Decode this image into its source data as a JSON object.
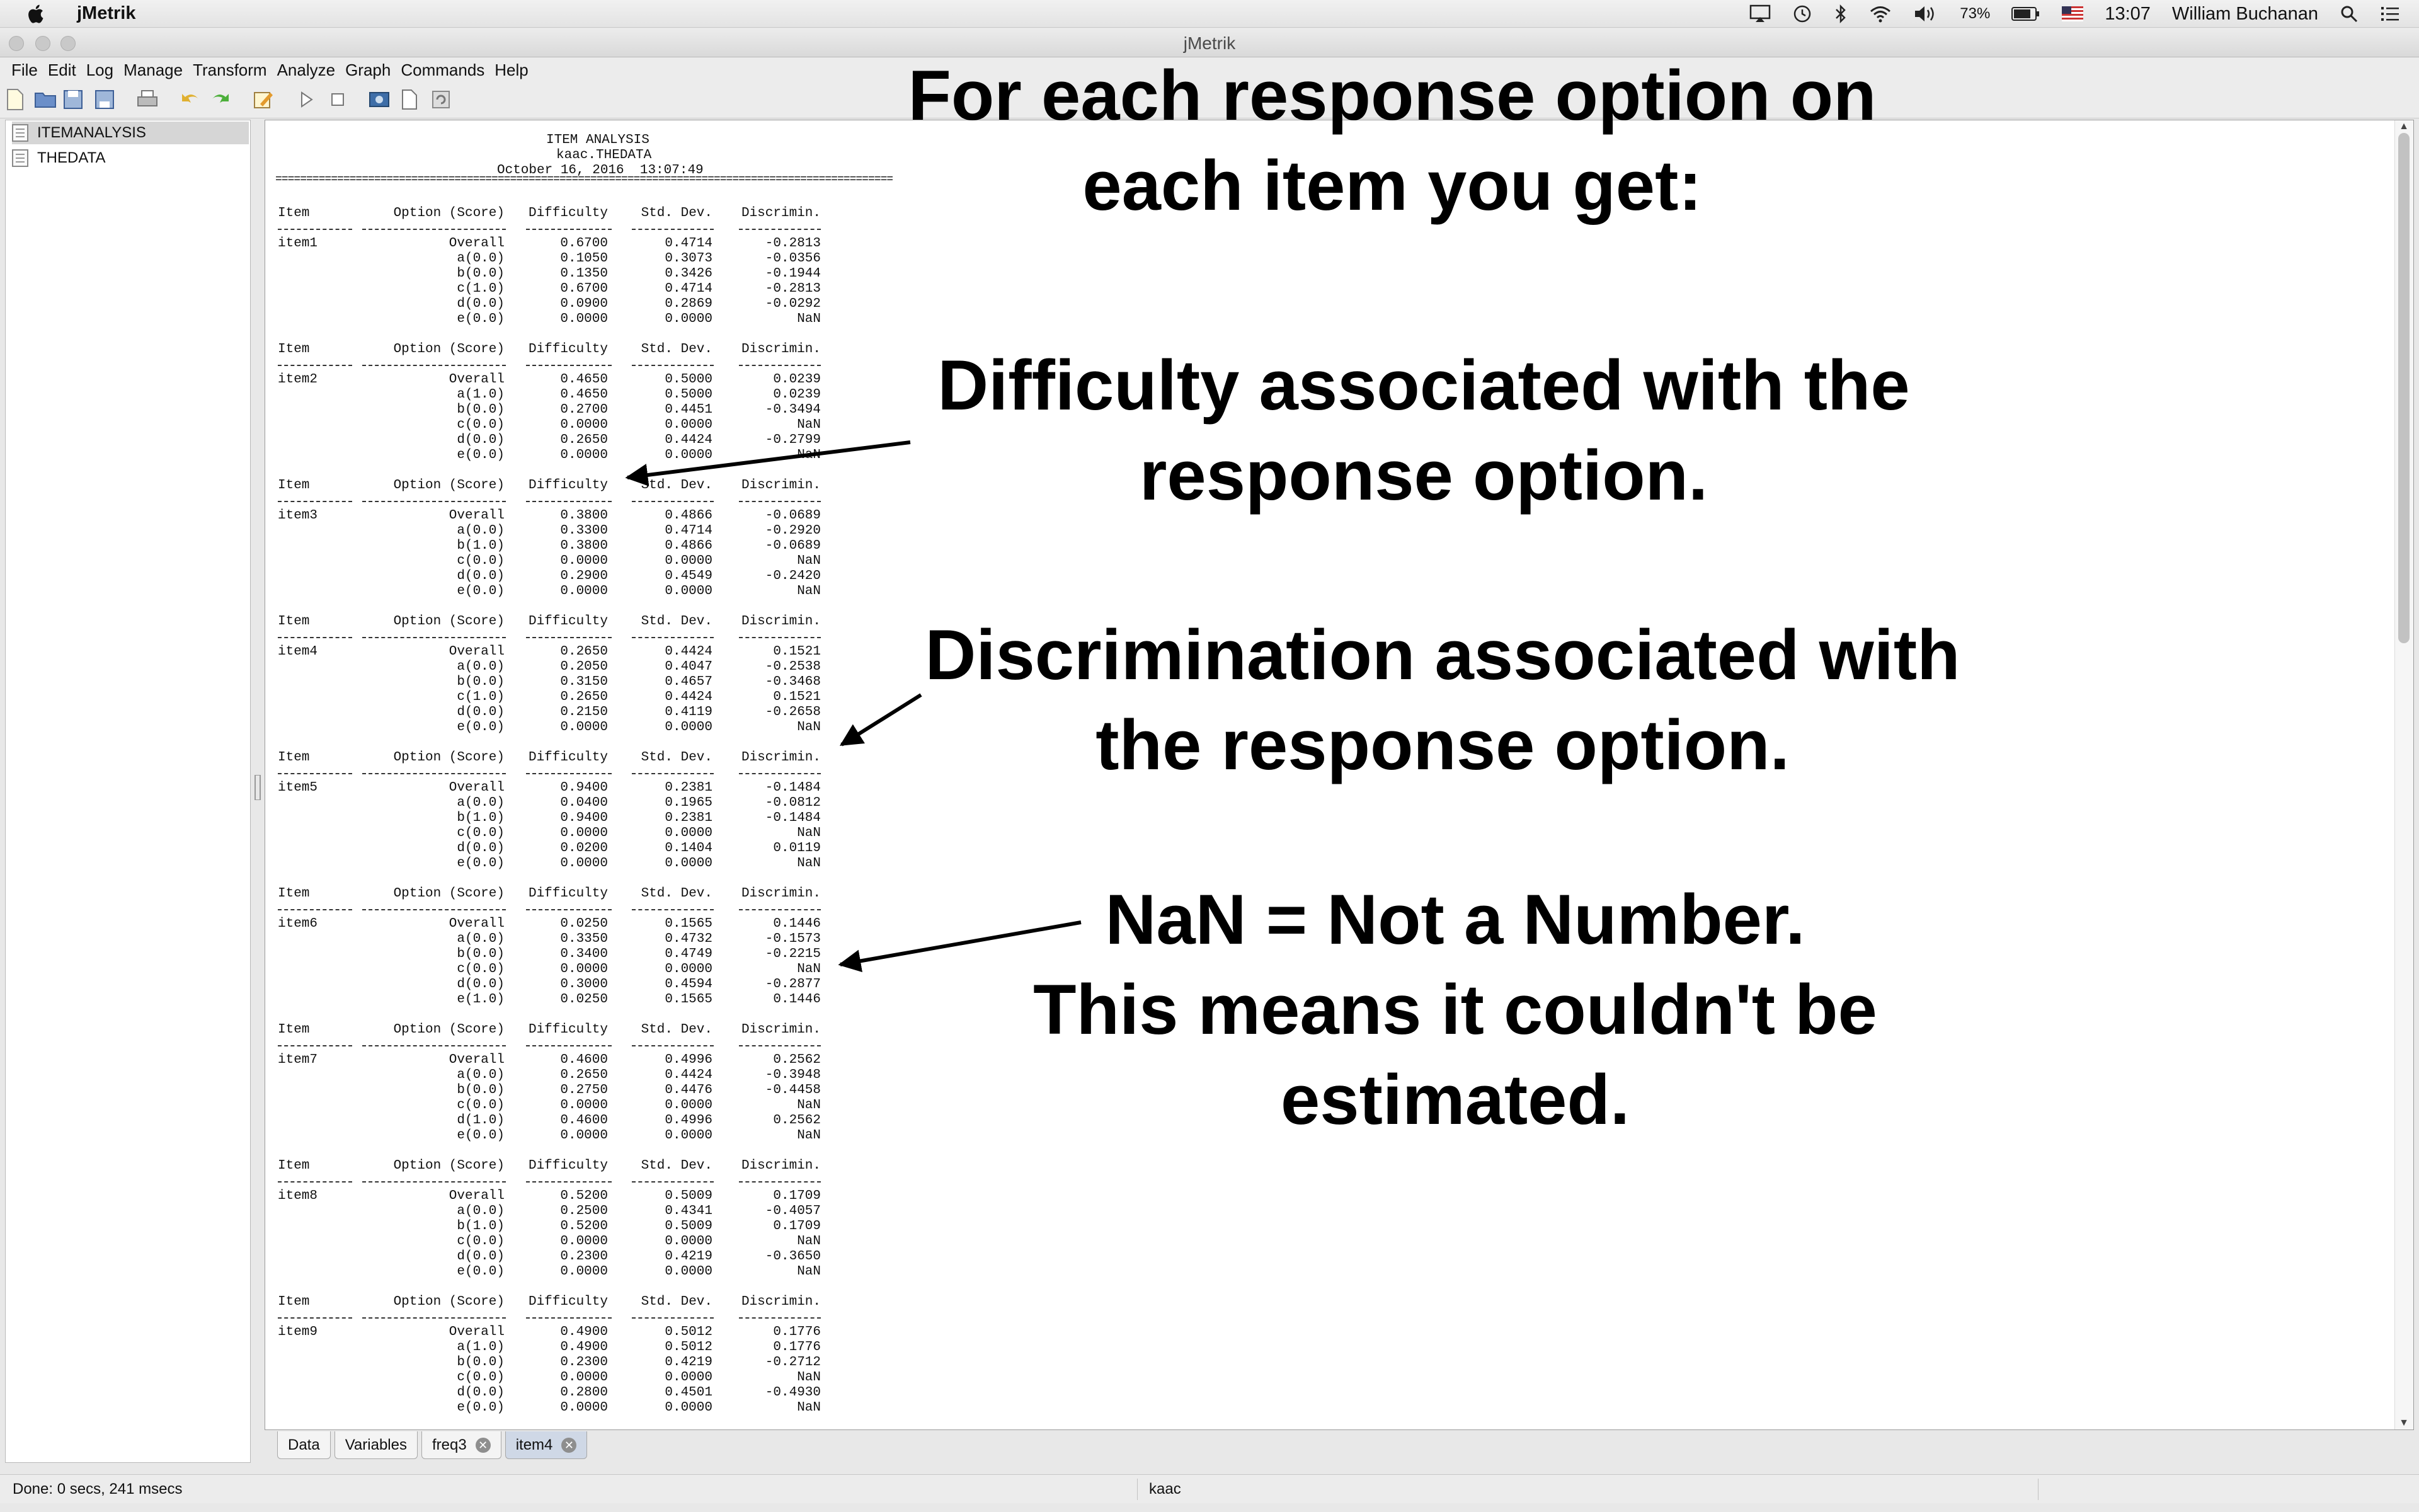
{
  "menubar": {
    "app_name": "jMetrik",
    "battery_pct": "73%",
    "clock": "13:07",
    "user": "William Buchanan"
  },
  "window": {
    "title": "jMetrik"
  },
  "app_menu": [
    "File",
    "Edit",
    "Log",
    "Manage",
    "Transform",
    "Analyze",
    "Graph",
    "Commands",
    "Help"
  ],
  "tree": {
    "items": [
      "ITEMANALYSIS",
      "THEDATA"
    ]
  },
  "report": {
    "title": "ITEM ANALYSIS",
    "table_name": "kaac.THEDATA",
    "datetime": "October 16, 2016  13:07:49",
    "separator": "==============================================================================================================",
    "columns": [
      "Item",
      "Option (Score)",
      "Difficulty",
      "Std. Dev.",
      "Discrimin."
    ],
    "items": [
      {
        "name": "item1",
        "rows": [
          [
            "Overall",
            "0.6700",
            "0.4714",
            "-0.2813"
          ],
          [
            "a(0.0)",
            "0.1050",
            "0.3073",
            "-0.0356"
          ],
          [
            "b(0.0)",
            "0.1350",
            "0.3426",
            "-0.1944"
          ],
          [
            "c(1.0)",
            "0.6700",
            "0.4714",
            "-0.2813"
          ],
          [
            "d(0.0)",
            "0.0900",
            "0.2869",
            "-0.0292"
          ],
          [
            "e(0.0)",
            "0.0000",
            "0.0000",
            "NaN"
          ]
        ]
      },
      {
        "name": "item2",
        "rows": [
          [
            "Overall",
            "0.4650",
            "0.5000",
            "0.0239"
          ],
          [
            "a(1.0)",
            "0.4650",
            "0.5000",
            "0.0239"
          ],
          [
            "b(0.0)",
            "0.2700",
            "0.4451",
            "-0.3494"
          ],
          [
            "c(0.0)",
            "0.0000",
            "0.0000",
            "NaN"
          ],
          [
            "d(0.0)",
            "0.2650",
            "0.4424",
            "-0.2799"
          ],
          [
            "e(0.0)",
            "0.0000",
            "0.0000",
            "NaN"
          ]
        ]
      },
      {
        "name": "item3",
        "rows": [
          [
            "Overall",
            "0.3800",
            "0.4866",
            "-0.0689"
          ],
          [
            "a(0.0)",
            "0.3300",
            "0.4714",
            "-0.2920"
          ],
          [
            "b(1.0)",
            "0.3800",
            "0.4866",
            "-0.0689"
          ],
          [
            "c(0.0)",
            "0.0000",
            "0.0000",
            "NaN"
          ],
          [
            "d(0.0)",
            "0.2900",
            "0.4549",
            "-0.2420"
          ],
          [
            "e(0.0)",
            "0.0000",
            "0.0000",
            "NaN"
          ]
        ]
      },
      {
        "name": "item4",
        "rows": [
          [
            "Overall",
            "0.2650",
            "0.4424",
            "0.1521"
          ],
          [
            "a(0.0)",
            "0.2050",
            "0.4047",
            "-0.2538"
          ],
          [
            "b(0.0)",
            "0.3150",
            "0.4657",
            "-0.3468"
          ],
          [
            "c(1.0)",
            "0.2650",
            "0.4424",
            "0.1521"
          ],
          [
            "d(0.0)",
            "0.2150",
            "0.4119",
            "-0.2658"
          ],
          [
            "e(0.0)",
            "0.0000",
            "0.0000",
            "NaN"
          ]
        ]
      },
      {
        "name": "item5",
        "rows": [
          [
            "Overall",
            "0.9400",
            "0.2381",
            "-0.1484"
          ],
          [
            "a(0.0)",
            "0.0400",
            "0.1965",
            "-0.0812"
          ],
          [
            "b(1.0)",
            "0.9400",
            "0.2381",
            "-0.1484"
          ],
          [
            "c(0.0)",
            "0.0000",
            "0.0000",
            "NaN"
          ],
          [
            "d(0.0)",
            "0.0200",
            "0.1404",
            "0.0119"
          ],
          [
            "e(0.0)",
            "0.0000",
            "0.0000",
            "NaN"
          ]
        ]
      },
      {
        "name": "item6",
        "rows": [
          [
            "Overall",
            "0.0250",
            "0.1565",
            "0.1446"
          ],
          [
            "a(0.0)",
            "0.3350",
            "0.4732",
            "-0.1573"
          ],
          [
            "b(0.0)",
            "0.3400",
            "0.4749",
            "-0.2215"
          ],
          [
            "c(0.0)",
            "0.0000",
            "0.0000",
            "NaN"
          ],
          [
            "d(0.0)",
            "0.3000",
            "0.4594",
            "-0.2877"
          ],
          [
            "e(1.0)",
            "0.0250",
            "0.1565",
            "0.1446"
          ]
        ]
      },
      {
        "name": "item7",
        "rows": [
          [
            "Overall",
            "0.4600",
            "0.4996",
            "0.2562"
          ],
          [
            "a(0.0)",
            "0.2650",
            "0.4424",
            "-0.3948"
          ],
          [
            "b(0.0)",
            "0.2750",
            "0.4476",
            "-0.4458"
          ],
          [
            "c(0.0)",
            "0.0000",
            "0.0000",
            "NaN"
          ],
          [
            "d(1.0)",
            "0.4600",
            "0.4996",
            "0.2562"
          ],
          [
            "e(0.0)",
            "0.0000",
            "0.0000",
            "NaN"
          ]
        ]
      },
      {
        "name": "item8",
        "rows": [
          [
            "Overall",
            "0.5200",
            "0.5009",
            "0.1709"
          ],
          [
            "a(0.0)",
            "0.2500",
            "0.4341",
            "-0.4057"
          ],
          [
            "b(1.0)",
            "0.5200",
            "0.5009",
            "0.1709"
          ],
          [
            "c(0.0)",
            "0.0000",
            "0.0000",
            "NaN"
          ],
          [
            "d(0.0)",
            "0.2300",
            "0.4219",
            "-0.3650"
          ],
          [
            "e(0.0)",
            "0.0000",
            "0.0000",
            "NaN"
          ]
        ]
      },
      {
        "name": "item9",
        "rows": [
          [
            "Overall",
            "0.4900",
            "0.5012",
            "0.1776"
          ],
          [
            "a(1.0)",
            "0.4900",
            "0.5012",
            "0.1776"
          ],
          [
            "b(0.0)",
            "0.2300",
            "0.4219",
            "-0.2712"
          ],
          [
            "c(0.0)",
            "0.0000",
            "0.0000",
            "NaN"
          ],
          [
            "d(0.0)",
            "0.2800",
            "0.4501",
            "-0.4930"
          ],
          [
            "e(0.0)",
            "0.0000",
            "0.0000",
            "NaN"
          ]
        ]
      }
    ]
  },
  "annotations": {
    "heading_line1": "For each response option on",
    "heading_line2": "each item you get:",
    "difficulty_line1": "Difficulty associated with the",
    "difficulty_line2": "response option.",
    "discrimination_line1": "Discrimination associated with",
    "discrimination_line2": "the response option.",
    "nan_line1": "NaN = Not a Number.",
    "nan_line2": "This means it couldn't be",
    "nan_line3": "estimated."
  },
  "tabs": [
    {
      "label": "Data",
      "closable": false
    },
    {
      "label": "Variables",
      "closable": false
    },
    {
      "label": "freq3",
      "closable": true
    },
    {
      "label": "item4",
      "closable": true,
      "active": true
    }
  ],
  "status": {
    "left": "Done: 0 secs, 241 msecs",
    "middle": "kaac"
  }
}
